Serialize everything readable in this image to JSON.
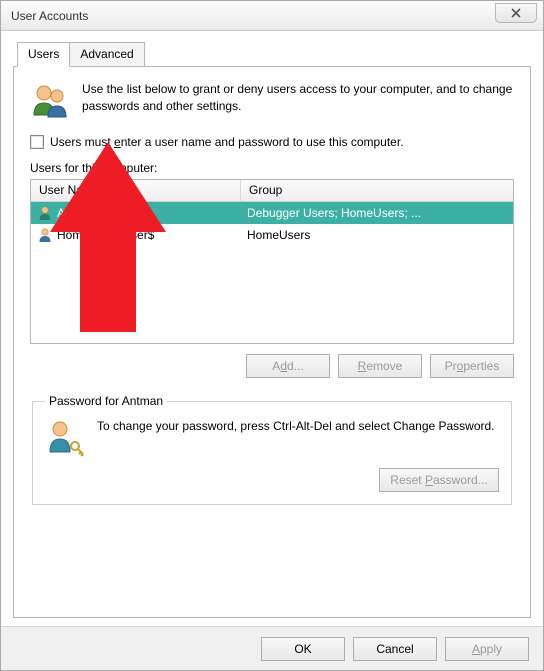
{
  "window": {
    "title": "User Accounts"
  },
  "tabs": {
    "users": "Users",
    "advanced": "Advanced"
  },
  "intro": "Use the list below to grant or deny users access to your computer, and to change passwords and other settings.",
  "checkbox_label_before": "Users must ",
  "checkbox_label_u": "e",
  "checkbox_label_after": "nter a user name and password to use this computer.",
  "list_label": "Users for this computer:",
  "columns": {
    "name": "User Name",
    "group": "Group"
  },
  "rows": [
    {
      "name": "Antman",
      "group": "Debugger Users; HomeUsers; ...",
      "selected": true
    },
    {
      "name": "HomeGroupUser$",
      "group": "HomeUsers",
      "selected": false
    }
  ],
  "buttons": {
    "add": "Add...",
    "add_u": "d",
    "remove": "Remove",
    "remove_u": "R",
    "properties": "Properties",
    "properties_u": "o",
    "reset": "Reset Password...",
    "reset_u": "P",
    "ok": "OK",
    "cancel": "Cancel",
    "apply": "Apply",
    "apply_u": "A"
  },
  "password_box": {
    "legend": "Password for Antman",
    "text": "To change your password, press Ctrl-Alt-Del and select Change Password."
  }
}
